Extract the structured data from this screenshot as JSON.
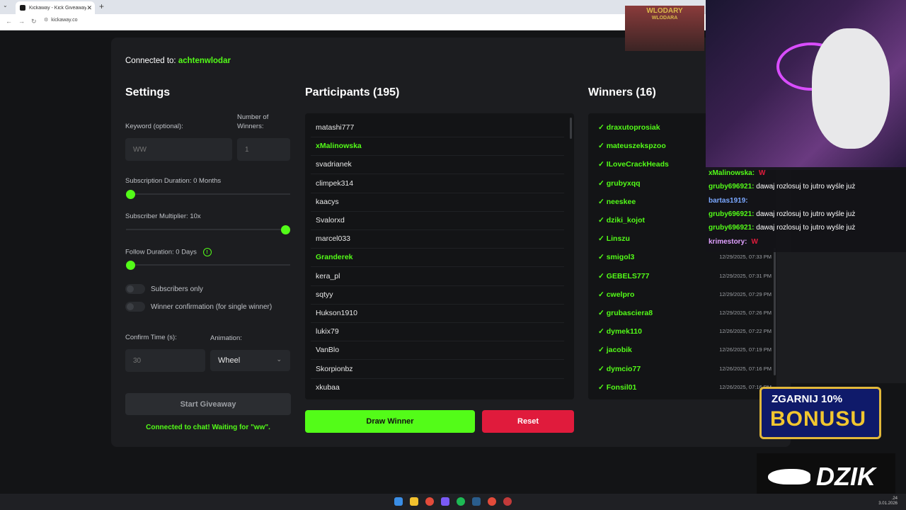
{
  "browser": {
    "tab_title": "Kickaway - Kick Giveaway Tool",
    "tab_close": "✕",
    "new_tab": "+",
    "url": "kickaway.co"
  },
  "connection": {
    "prefix": "Connected to:",
    "channel": "achtenwlodar"
  },
  "settings": {
    "title": "Settings",
    "keyword_label": "Keyword (optional):",
    "keyword_placeholder": "WW",
    "winners_label": "Number of Winners:",
    "winners_placeholder": "1",
    "sub_duration_label": "Subscription Duration: 0 Months",
    "sub_duration_value": 0,
    "sub_multiplier_label": "Subscriber Multiplier: 10x",
    "sub_multiplier_value": 10,
    "follow_duration_label": "Follow Duration: 0 Days",
    "follow_duration_value": 0,
    "subscribers_only_label": "Subscribers only",
    "subscribers_only": false,
    "winner_confirm_label": "Winner confirmation (for single winner)",
    "winner_confirm": false,
    "confirm_time_label": "Confirm Time (s):",
    "confirm_time_placeholder": "30",
    "animation_label": "Animation:",
    "animation_value": "Wheel",
    "start_label": "Start Giveaway",
    "status": "Connected to chat! Waiting for \"ww\"."
  },
  "participants": {
    "title": "Participants (195)",
    "items": [
      {
        "name": "matashi777",
        "winner": false
      },
      {
        "name": "xMalinowska",
        "winner": true
      },
      {
        "name": "svadrianek",
        "winner": false
      },
      {
        "name": "climpek314",
        "winner": false
      },
      {
        "name": "kaacys",
        "winner": false
      },
      {
        "name": "Svalorxd",
        "winner": false
      },
      {
        "name": "marcel033",
        "winner": false
      },
      {
        "name": "Granderek",
        "winner": true
      },
      {
        "name": "kera_pl",
        "winner": false
      },
      {
        "name": "sqtyy",
        "winner": false
      },
      {
        "name": "Hukson1910",
        "winner": false
      },
      {
        "name": "lukix79",
        "winner": false
      },
      {
        "name": "VanBlo",
        "winner": false
      },
      {
        "name": "Skorpionbz",
        "winner": false
      },
      {
        "name": "xkubaa",
        "winner": false
      }
    ]
  },
  "winners": {
    "title": "Winners (16)",
    "items": [
      {
        "name": "✓ draxutoprosiak",
        "time": ""
      },
      {
        "name": "✓ mateuszekspzoo",
        "time": ""
      },
      {
        "name": "✓ ILoveCrackHeads",
        "time": ""
      },
      {
        "name": "✓ grubyxqq",
        "time": ""
      },
      {
        "name": "✓ neeskee",
        "time": ""
      },
      {
        "name": "✓ dziki_kojot",
        "time": ""
      },
      {
        "name": "✓ Linszu",
        "time": ""
      },
      {
        "name": "✓ smigol3",
        "time": "12/29/2025, 07:33 PM"
      },
      {
        "name": "✓ GEBELS777",
        "time": "12/29/2025, 07:31 PM"
      },
      {
        "name": "✓ cwelpro",
        "time": "12/29/2025, 07:29 PM"
      },
      {
        "name": "✓ grubasciera8",
        "time": "12/29/2025, 07:26 PM"
      },
      {
        "name": "✓ dymek110",
        "time": "12/26/2025, 07:22 PM"
      },
      {
        "name": "✓ jacobik",
        "time": "12/26/2025, 07:19 PM"
      },
      {
        "name": "✓ dymcio77",
        "time": "12/26/2025, 07:16 PM"
      },
      {
        "name": "✓ Fonsil01",
        "time": "12/26/2025, 07:16 PM"
      }
    ]
  },
  "actions": {
    "draw": "Draw Winner",
    "reset": "Reset"
  },
  "overlay": {
    "badge_title": "WLODARY",
    "badge_sub": "WLODARA",
    "chat": [
      {
        "user": "xMalinowska:",
        "user_color": "#53fc18",
        "msg": "",
        "emote": "W"
      },
      {
        "user": "gruby696921:",
        "user_color": "#53fc18",
        "msg": " dawaj rozlosuj to jutro wyśle już",
        "emote": ""
      },
      {
        "user": "bartas1919:",
        "user_color": "#7aa7ff",
        "msg": "",
        "emote": ""
      },
      {
        "user": "gruby696921:",
        "user_color": "#53fc18",
        "msg": " dawaj rozlosuj to jutro wyśle już",
        "emote": ""
      },
      {
        "user": "gruby696921:",
        "user_color": "#53fc18",
        "msg": " dawaj rozlosuj to jutro wyśle już",
        "emote": ""
      },
      {
        "user": "krimestory:",
        "user_color": "#e0a0ff",
        "msg": "",
        "emote": "W"
      }
    ],
    "promo_line1": "ZGARNIJ 10%",
    "promo_line2": "BONUSU",
    "brand": "DZIK"
  },
  "taskbar": {
    "time": ".24",
    "date": "3.01.2026"
  }
}
